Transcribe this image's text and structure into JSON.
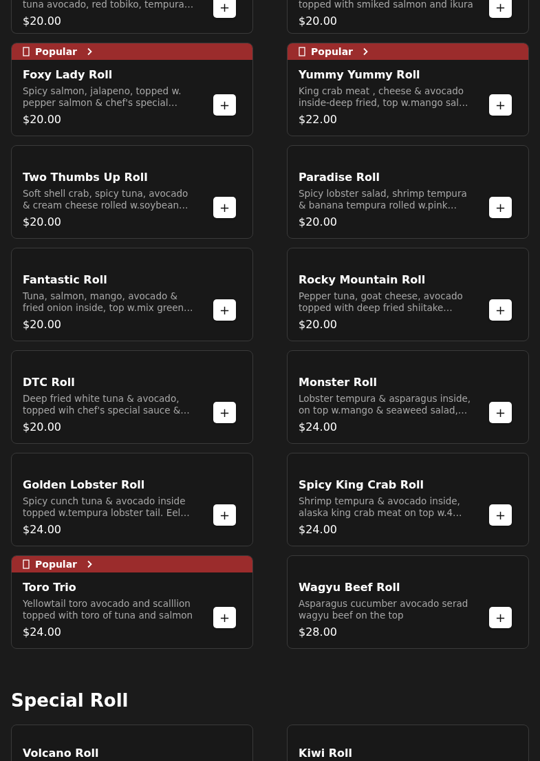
{
  "sections": [
    {
      "items": [
        {
          "description": "tuna avocado, red tobiko, tempura…",
          "price": "$20.00",
          "popular": false,
          "add": "+"
        },
        {
          "description": "topped with smiked salmon and ikura",
          "price": "$20.00",
          "popular": false,
          "add": "+"
        },
        {
          "badge": "Popular",
          "name": "Foxy Lady Roll",
          "description": "Spicy salmon, jalapeno, topped w. pepper salmon & chef's special…",
          "price": "$20.00",
          "popular": true,
          "add": "+"
        },
        {
          "badge": "Popular",
          "name": "Yummy Yummy Roll",
          "description": "King crab meat , cheese & avocado inside-deep fried, top w.mango sal…",
          "price": "$22.00",
          "popular": true,
          "add": "+"
        },
        {
          "name": "Two Thumbs Up Roll",
          "description": "Soft shell crab, spicy tuna, avocado & cream cheese rolled w.soybean…",
          "price": "$20.00",
          "popular": false,
          "add": "+"
        },
        {
          "name": "Paradise Roll",
          "description": "Spicy lobster salad, shrimp tempura & banana tempura rolled w.pink…",
          "price": "$20.00",
          "popular": false,
          "add": "+"
        },
        {
          "name": "Fantastic Roll",
          "description": "Tuna, salmon, mango, avocado & fried onion inside, top w.mix green…",
          "price": "$20.00",
          "popular": false,
          "add": "+"
        },
        {
          "name": "Rocky Mountain Roll",
          "description": "Pepper tuna, goat cheese, avocado topped with deep fried shiitake…",
          "price": "$20.00",
          "popular": false,
          "add": "+"
        },
        {
          "name": "DTC Roll",
          "description": "Deep fried white tuna & avocado, topped wih chef's special sauce &…",
          "price": "$20.00",
          "popular": false,
          "add": "+"
        },
        {
          "name": "Monster Roll",
          "description": "Lobster tempura & asparagus inside, on top w.mango & seaweed salad,…",
          "price": "$24.00",
          "popular": false,
          "add": "+"
        },
        {
          "name": "Golden Lobster Roll",
          "description": "Spicy cunch tuna & avocado inside topped w.tempura lobster tail. Eel…",
          "price": "$24.00",
          "popular": false,
          "add": "+"
        },
        {
          "name": "Spicy King Crab Roll",
          "description": "Shrimp tempura & avocado inside, alaska king crab meat on top w.4…",
          "price": "$24.00",
          "popular": false,
          "add": "+"
        },
        {
          "badge": "Popular",
          "name": "Toro Trio",
          "description": "Yellowtail toro avocado and scalllion topped with toro of tuna and salmon",
          "price": "$24.00",
          "popular": true,
          "add": "+"
        },
        {
          "name": "Wagyu Beef Roll",
          "description": "Asparagus cucumber avocado serad wagyu beef on the top",
          "price": "$28.00",
          "popular": false,
          "add": "+"
        }
      ]
    },
    {
      "title": "Special Roll",
      "items": [
        {
          "name": "Volcano Roll",
          "popular": false
        },
        {
          "name": "Kiwi Roll",
          "popular": false
        }
      ]
    }
  ]
}
